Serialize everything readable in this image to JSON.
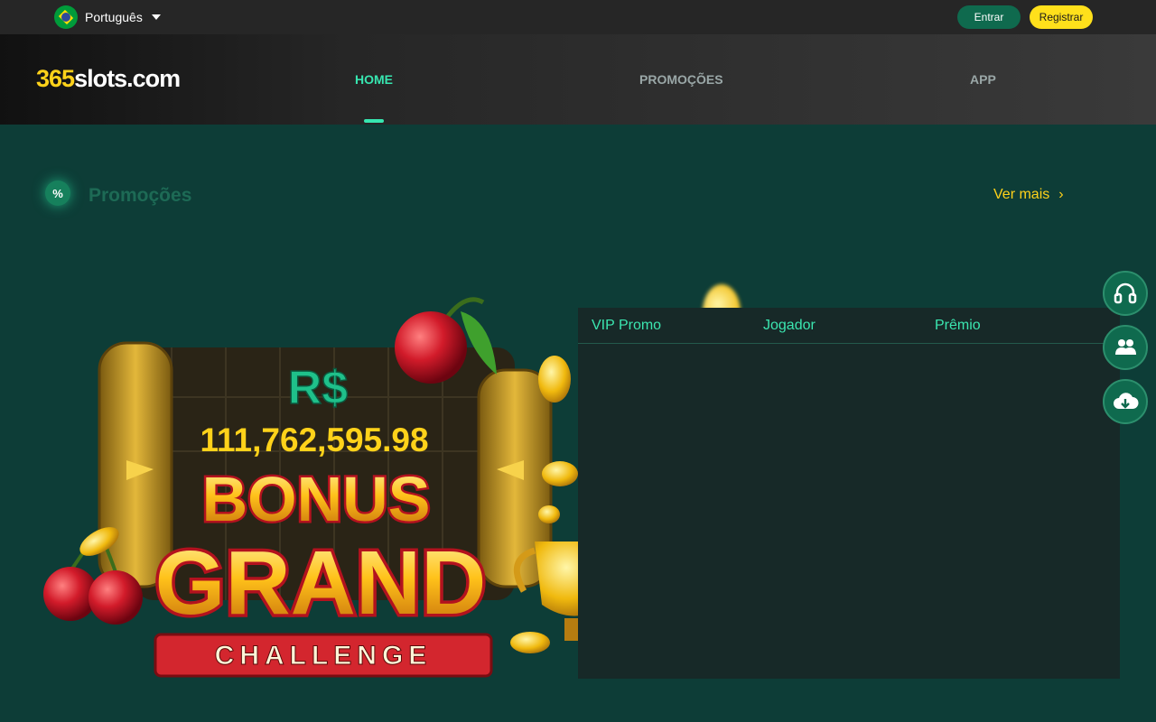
{
  "topbar": {
    "language": "Português",
    "login_label": "Entrar",
    "register_label": "Registrar"
  },
  "header": {
    "logo_prefix": "365",
    "logo_suffix": "slots.com",
    "nav": [
      {
        "label": "HOME",
        "active": true
      },
      {
        "label": "PROMOÇÕES",
        "active": false
      },
      {
        "label": "APP",
        "active": false
      }
    ]
  },
  "section": {
    "title": "Promoções",
    "more_label": "Ver mais",
    "more_arrow": "›"
  },
  "banner": {
    "currency": "R$",
    "jackpot": "111,762,595.98",
    "line1": "BONUS",
    "line2": "GRAND",
    "line3": "CHALLENGE"
  },
  "table": {
    "headers": [
      "VIP Promo",
      "Jogador",
      "Prêmio"
    ],
    "rows": []
  },
  "side_buttons": [
    {
      "icon": "headset-icon"
    },
    {
      "icon": "users-icon"
    },
    {
      "icon": "cloud-download-icon"
    }
  ],
  "colors": {
    "background": "#0d3d37",
    "accent": "#37e6b0",
    "brand_yellow": "#ffd21a",
    "button_green": "#0f6a4e"
  }
}
